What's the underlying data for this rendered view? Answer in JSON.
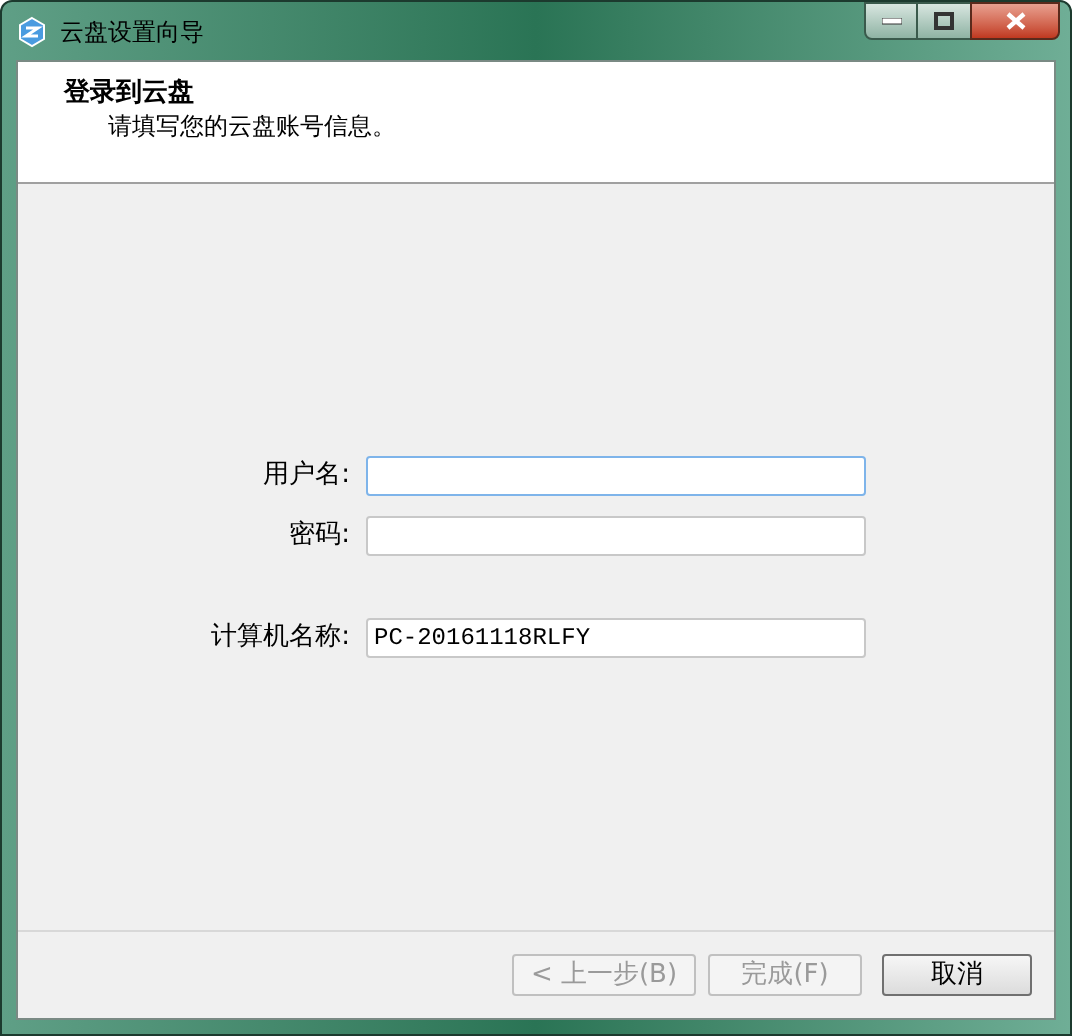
{
  "window": {
    "title": "云盘设置向导"
  },
  "header": {
    "title": "登录到云盘",
    "subtitle": "请填写您的云盘账号信息。"
  },
  "fields": [
    {
      "label": "用户名:",
      "focused": true
    },
    {
      "label": "密码:",
      "focused": false
    },
    {
      "label": "计算机名称:",
      "value": "PC-20161118RLFY",
      "focused": false
    }
  ],
  "buttons": [
    {
      "label": "< 上一步(B)",
      "disabled": true
    },
    {
      "label": "完成(F)",
      "disabled": true
    },
    {
      "label": "取消",
      "disabled": false
    }
  ]
}
